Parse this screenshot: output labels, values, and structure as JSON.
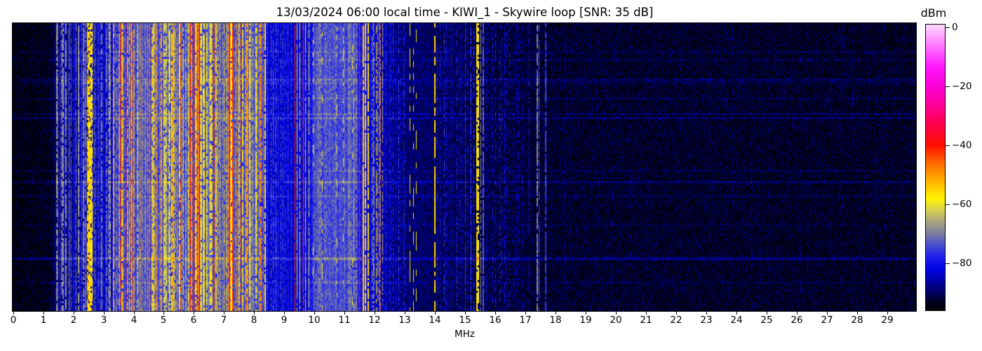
{
  "title": "13/03/2024 06:00 local time - KIWI_1 - Skywire loop [SNR: 35 dB]",
  "axes": {
    "xlabel": "MHz",
    "xticks": [
      "0",
      "1",
      "2",
      "3",
      "4",
      "5",
      "6",
      "7",
      "8",
      "9",
      "10",
      "11",
      "12",
      "13",
      "14",
      "15",
      "16",
      "17",
      "18",
      "19",
      "20",
      "21",
      "22",
      "23",
      "24",
      "25",
      "26",
      "27",
      "28",
      "29"
    ],
    "x_min": 0,
    "x_max": 29.97
  },
  "colorbar": {
    "label": "dBm",
    "vmin": -96,
    "vmax": 1,
    "ticks": [
      {
        "value": 0,
        "label": "0"
      },
      {
        "value": -20,
        "label": "−20"
      },
      {
        "value": -40,
        "label": "−40"
      },
      {
        "value": -60,
        "label": "−60"
      },
      {
        "value": -80,
        "label": "−80"
      }
    ]
  },
  "chart_data": {
    "type": "heatmap",
    "subtype": "radio-spectrogram-waterfall",
    "title": "13/03/2024 06:00 local time - KIWI_1 - Skywire loop [SNR: 35 dB]",
    "xlabel": "MHz",
    "x_range": [
      0,
      29.97
    ],
    "y_axis": "time (unlabeled)",
    "value_unit": "dBm",
    "value_range": [
      -96,
      1
    ],
    "grid": false,
    "legend_position": "colorbar-right",
    "colormap_stops": [
      [
        -96,
        "#000000"
      ],
      [
        -93,
        "#000128"
      ],
      [
        -90,
        "#000160"
      ],
      [
        -86,
        "#0002a8"
      ],
      [
        -82,
        "#0004e4"
      ],
      [
        -78,
        "#1c1fee"
      ],
      [
        -74,
        "#4a4fd0"
      ],
      [
        -70,
        "#7e7f9e"
      ],
      [
        -66,
        "#a8a47e"
      ],
      [
        -62,
        "#d8d255"
      ],
      [
        -58,
        "#fff200"
      ],
      [
        -52,
        "#ffb200"
      ],
      [
        -46,
        "#ff6a00"
      ],
      [
        -40,
        "#ff1000"
      ],
      [
        -33,
        "#ff004a"
      ],
      [
        -27,
        "#ff0090"
      ],
      [
        -20,
        "#fb00d8"
      ],
      [
        -13,
        "#ff1aff"
      ],
      [
        -6,
        "#ff7aff"
      ],
      [
        1,
        "#ffd9ff"
      ]
    ],
    "noise_floor_envelope": [
      [
        0,
        -95
      ],
      [
        1.2,
        -94
      ],
      [
        1.5,
        -89
      ],
      [
        2.4,
        -87
      ],
      [
        3.2,
        -84
      ],
      [
        3.5,
        -77
      ],
      [
        4.0,
        -75
      ],
      [
        8.2,
        -75
      ],
      [
        8.5,
        -83
      ],
      [
        9.3,
        -83
      ],
      [
        9.9,
        -80
      ],
      [
        10.3,
        -77
      ],
      [
        11.3,
        -77
      ],
      [
        11.6,
        -80
      ],
      [
        12.3,
        -86
      ],
      [
        13.0,
        -89
      ],
      [
        14.0,
        -90
      ],
      [
        15.5,
        -91
      ],
      [
        16.5,
        -92
      ],
      [
        18.0,
        -93
      ],
      [
        29.97,
        -93.5
      ]
    ],
    "carrier_zones": [
      {
        "f0": 1.45,
        "f1": 2.45,
        "spacing": 0.055,
        "lmin": -80,
        "lmax": -68,
        "wmax": 2,
        "duty": 0.85
      },
      {
        "f0": 2.47,
        "f1": 2.62,
        "spacing": 0.03,
        "lmin": -60,
        "lmax": -55,
        "wmax": 2,
        "duty": 0.8
      },
      {
        "f0": 2.65,
        "f1": 3.15,
        "spacing": 0.05,
        "lmin": -80,
        "lmax": -69,
        "wmax": 2,
        "duty": 0.8
      },
      {
        "f0": 3.2,
        "f1": 8.35,
        "spacing": 0.05,
        "lmin": -74,
        "lmax": -56,
        "wmax": 2,
        "duty": 0.85,
        "hot": 0.18,
        "hmin": -54,
        "hmax": -44
      },
      {
        "f0": 8.4,
        "f1": 9.3,
        "spacing": 0.07,
        "lmin": -82,
        "lmax": -72,
        "wmax": 1,
        "duty": 0.7
      },
      {
        "f0": 9.95,
        "f1": 11.45,
        "spacing": 0.026,
        "lmin": -77,
        "lmax": -70,
        "wmax": 2,
        "duty": 0.9
      },
      {
        "f0": 10.0,
        "f1": 11.4,
        "spacing": 0.33,
        "lmin": -64,
        "lmax": -58,
        "wmax": 1,
        "duty": 0.25,
        "dash": 2
      },
      {
        "f0": 11.9,
        "f1": 12.28,
        "spacing": 0.05,
        "lmin": -72,
        "lmax": -64,
        "wmax": 1,
        "duty": 0.7
      },
      {
        "f0": 12.3,
        "f1": 13.1,
        "spacing": 0.08,
        "lmin": -82,
        "lmax": -74,
        "wmax": 1,
        "duty": 0.6
      },
      {
        "f0": 14.1,
        "f1": 15.28,
        "spacing": 0.09,
        "lmin": -84,
        "lmax": -76,
        "wmax": 1,
        "duty": 0.55
      },
      {
        "f0": 15.7,
        "f1": 17.0,
        "spacing": 0.11,
        "lmin": -86,
        "lmax": -78,
        "wmax": 1,
        "duty": 0.45
      },
      {
        "f0": 18.0,
        "f1": 29.9,
        "spacing": 0.5,
        "lmin": -90,
        "lmax": -85,
        "wmax": 1,
        "duty": 0.15,
        "dash": 2
      }
    ],
    "signals": [
      {
        "f": 3.33,
        "level": -50,
        "w": 0.03
      },
      {
        "f": 3.56,
        "level": -40,
        "w": 0.025,
        "duty": 0.9
      },
      {
        "f": 3.74,
        "level": -41,
        "w": 0.025,
        "duty": 0.9
      },
      {
        "f": 3.9,
        "level": -46,
        "w": 0.03,
        "duty": 0.85
      },
      {
        "f": 4.25,
        "level": -44,
        "w": 0.03,
        "duty": 0.85
      },
      {
        "f": 4.47,
        "level": -47,
        "w": 0.03
      },
      {
        "f": 4.77,
        "level": -49,
        "w": 0.03
      },
      {
        "f": 5.3,
        "level": -47,
        "w": 0.03
      },
      {
        "f": 5.55,
        "level": -43,
        "w": 0.03,
        "duty": 0.9
      },
      {
        "f": 5.9,
        "level": -44,
        "w": 0.04,
        "duty": 0.9
      },
      {
        "f": 6.0,
        "level": -40,
        "w": 0.04,
        "duty": 0.92
      },
      {
        "f": 6.17,
        "level": -38,
        "w": 0.05,
        "duty": 0.95
      },
      {
        "f": 7.17,
        "level": -36,
        "w": 0.04,
        "duty": 0.97
      },
      {
        "f": 7.3,
        "level": -43,
        "w": 0.04,
        "duty": 0.9
      },
      {
        "f": 7.42,
        "level": -47,
        "w": 0.03
      },
      {
        "f": 9.35,
        "level": -41,
        "w": 0.03,
        "duty": 0.95
      },
      {
        "f": 9.42,
        "level": -55,
        "w": 0.03
      },
      {
        "f": 9.51,
        "level": -57,
        "w": 0.03
      },
      {
        "f": 9.64,
        "level": -42,
        "w": 0.03,
        "duty": 0.95
      },
      {
        "f": 9.71,
        "level": -54,
        "w": 0.03
      },
      {
        "f": 9.81,
        "level": -59,
        "w": 0.03
      },
      {
        "f": 11.5,
        "level": -40,
        "w": 0.025,
        "duty": 0.95
      },
      {
        "f": 11.62,
        "level": -55,
        "w": 0.05,
        "duty": 0.9
      },
      {
        "f": 11.7,
        "level": -54,
        "w": 0.05,
        "duty": 0.9
      },
      {
        "f": 11.79,
        "level": -56,
        "w": 0.04,
        "duty": 0.85
      },
      {
        "f": 12.05,
        "level": -58,
        "w": 0.03,
        "duty": 0.7
      },
      {
        "f": 12.17,
        "level": -42,
        "w": 0.025,
        "duty": 0.95
      },
      {
        "f": 13.16,
        "level": -57,
        "w": 0.03,
        "duty": 0.4,
        "dash": 3
      },
      {
        "f": 13.28,
        "level": -58,
        "w": 0.03,
        "duty": 0.35,
        "dash": 3
      },
      {
        "f": 13.38,
        "level": -59,
        "w": 0.025,
        "duty": 0.3,
        "dash": 3
      },
      {
        "f": 14.0,
        "level": -56,
        "w": 0.04,
        "duty": 0.7,
        "dash": 2
      },
      {
        "f": 15.0,
        "level": -77,
        "w": 0.03
      },
      {
        "f": 15.2,
        "level": -75,
        "w": 0.03
      },
      {
        "f": 15.38,
        "level": -56,
        "w": 0.05,
        "duty": 0.9
      },
      {
        "f": 15.44,
        "level": -58,
        "w": 0.04,
        "duty": 0.85
      },
      {
        "f": 15.52,
        "level": -68,
        "w": 0.03
      },
      {
        "f": 15.61,
        "level": -73,
        "w": 0.05
      },
      {
        "f": 16.3,
        "level": -80,
        "w": 0.03,
        "duty": 0.7
      },
      {
        "f": 17.12,
        "level": -80,
        "w": 0.03,
        "duty": 0.6
      },
      {
        "f": 17.4,
        "level": -70,
        "w": 0.04,
        "duty": 0.85,
        "flick": 3
      },
      {
        "f": 17.46,
        "level": -74,
        "w": 0.03,
        "duty": 0.8
      },
      {
        "f": 17.67,
        "level": -76,
        "w": 0.04,
        "duty": 0.8
      },
      {
        "f": 18.3,
        "level": -86,
        "w": 0.025,
        "duty": 0.5
      }
    ],
    "horizontal_streaks": [
      {
        "r": 0.1,
        "b": 3,
        "w": 1
      },
      {
        "r": 0.127,
        "b": 3,
        "w": 1
      },
      {
        "r": 0.195,
        "b": 4,
        "w": 1
      },
      {
        "r": 0.205,
        "b": 2,
        "w": 4
      },
      {
        "r": 0.26,
        "b": 3,
        "w": 1
      },
      {
        "r": 0.315,
        "b": 4,
        "w": 1
      },
      {
        "r": 0.33,
        "b": 5,
        "w": 1
      },
      {
        "r": 0.512,
        "b": 3,
        "w": 1
      },
      {
        "r": 0.552,
        "b": 6,
        "w": 1
      },
      {
        "r": 0.6,
        "b": 3,
        "w": 1
      },
      {
        "r": 0.7,
        "b": 2,
        "w": 1
      },
      {
        "r": 0.818,
        "b": 7,
        "w": 2
      },
      {
        "r": 0.9,
        "b": 3,
        "w": 1
      }
    ]
  }
}
